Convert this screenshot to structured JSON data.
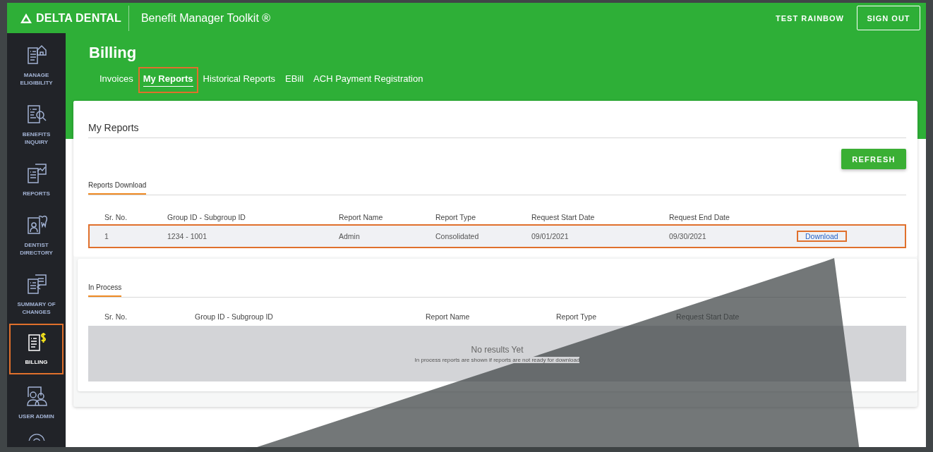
{
  "header": {
    "brand": "DELTA DENTAL",
    "title": "Benefit Manager Toolkit ®",
    "user": "TEST RAINBOW",
    "sign_out": "SIGN OUT"
  },
  "sidebar": {
    "items": [
      {
        "label": "MANAGE ELIGIBILITY",
        "selected": false,
        "highlighted": false
      },
      {
        "label": "BENEFITS INQUIRY",
        "selected": false,
        "highlighted": false
      },
      {
        "label": "REPORTS",
        "selected": false,
        "highlighted": false
      },
      {
        "label": "DENTIST DIRECTORY",
        "selected": false,
        "highlighted": false
      },
      {
        "label": "SUMMARY OF CHANGES",
        "selected": false,
        "highlighted": false
      },
      {
        "label": "BILLING",
        "selected": true,
        "highlighted": true
      },
      {
        "label": "USER ADMIN",
        "selected": false,
        "highlighted": false
      }
    ]
  },
  "page": {
    "title": "Billing",
    "tabs": [
      {
        "label": "Invoices",
        "selected": false,
        "highlighted": false
      },
      {
        "label": "My Reports",
        "selected": true,
        "highlighted": true
      },
      {
        "label": "Historical Reports",
        "selected": false,
        "highlighted": false
      },
      {
        "label": "EBill",
        "selected": false,
        "highlighted": false
      },
      {
        "label": "ACH Payment Registration",
        "selected": false,
        "highlighted": false
      }
    ]
  },
  "reports": {
    "title": "My Reports",
    "refresh": "REFRESH",
    "section": "Reports Download",
    "columns": [
      "Sr. No.",
      "Group ID - Subgroup ID",
      "Report Name",
      "Report Type",
      "Request Start Date",
      "Request End Date"
    ],
    "rows": [
      {
        "cells": [
          "1",
          "1234 - 1001",
          "Admin",
          "Consolidated",
          "09/01/2021",
          "09/30/2021"
        ],
        "action": "Download",
        "highlighted": true,
        "action_highlighted": true
      }
    ]
  },
  "in_process": {
    "section": "In Process",
    "columns": [
      "Sr. No.",
      "Group ID - Subgroup ID",
      "Report Name",
      "Report Type",
      "Request Start Date"
    ],
    "empty_title": "No results Yet",
    "empty_text": "In process reports are shown if reports are not ready for download"
  }
}
